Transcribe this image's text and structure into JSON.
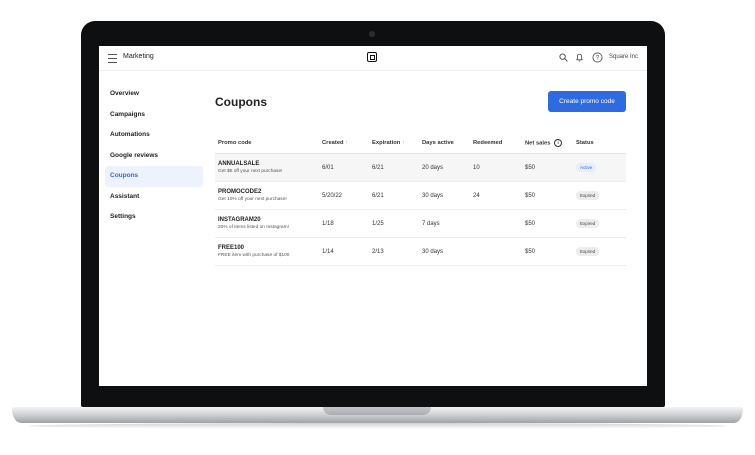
{
  "header": {
    "app_title": "Marketing",
    "account_name": "Square Inc"
  },
  "sidebar": {
    "items": [
      {
        "label": "Overview"
      },
      {
        "label": "Campaigns"
      },
      {
        "label": "Automations"
      },
      {
        "label": "Google reviews"
      },
      {
        "label": "Coupons",
        "active": true
      },
      {
        "label": "Assistant"
      },
      {
        "label": "Settings"
      }
    ]
  },
  "main": {
    "title": "Coupons",
    "create_button": "Create promo code",
    "table": {
      "headers": {
        "promo_code": "Promo code",
        "created": "Created",
        "expiration": "Expiration",
        "days_active": "Days active",
        "redeemed": "Redeemed",
        "net_sales": "Net sales",
        "status": "Status"
      },
      "sort_arrow": "↑",
      "info_glyph": "i",
      "rows": [
        {
          "code": "ANNUALSALE",
          "desc": "Get $5 off your next purchase!",
          "created": "6/01",
          "expiration": "6/21",
          "days": "20 days",
          "redeemed": "10",
          "net": "$50",
          "status": "Active"
        },
        {
          "code": "PROMOCODE2",
          "desc": "Get 10% off your next purchase!",
          "created": "5/20/22",
          "expiration": "6/21",
          "days": "30 days",
          "redeemed": "24",
          "net": "$50",
          "status": "Expired"
        },
        {
          "code": "INSTAGRAM20",
          "desc": "20% of items listed on Instagram!",
          "created": "1/18",
          "expiration": "1/25",
          "days": "7 days",
          "redeemed": "",
          "net": "$50",
          "status": "Expired"
        },
        {
          "code": "FREE100",
          "desc": "FREE item with purchase of $100",
          "created": "1/14",
          "expiration": "2/13",
          "days": "30 days",
          "redeemed": "",
          "net": "$50",
          "status": "Expired"
        }
      ]
    }
  },
  "colors": {
    "accent": "#2f6ae0",
    "active_bg": "#eef2fd",
    "laptop_bezel": "#0e0f11"
  },
  "icons": [
    "menu-icon",
    "square-logo",
    "search-icon",
    "bell-icon",
    "help-icon",
    "info-icon",
    "sort-arrow-icon"
  ]
}
